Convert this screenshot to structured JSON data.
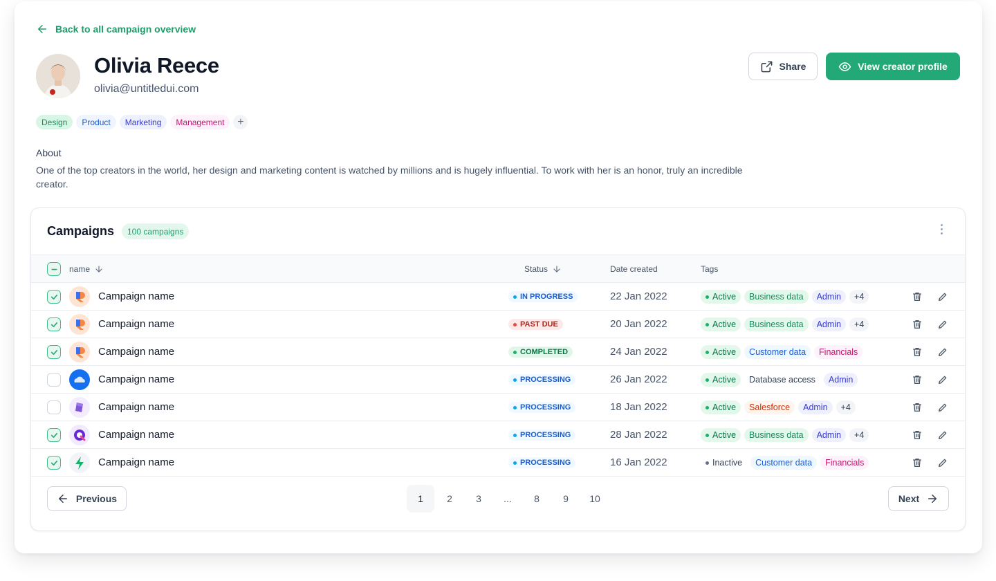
{
  "back_link": "Back to all campaign overview",
  "profile": {
    "name": "Olivia Reece",
    "email": "olivia@untitledui.com"
  },
  "actions": {
    "share_label": "Share",
    "view_label": "View creator profile"
  },
  "profile_tags": [
    {
      "label": "Design",
      "bg": "#d8f5e6",
      "fg": "#1f8a5b"
    },
    {
      "label": "Product",
      "bg": "#eff4ff",
      "fg": "#175cd3"
    },
    {
      "label": "Marketing",
      "bg": "#eef0fc",
      "fg": "#3538cd"
    },
    {
      "label": "Management",
      "bg": "#fdf2fa",
      "fg": "#c11574"
    }
  ],
  "add_tag": "+",
  "about": {
    "label": "About",
    "text": "One of the top creators in the world, her design and marketing content is watched by millions and is hugely influential. To work with her is an honor, truly an incredible creator."
  },
  "campaigns": {
    "title": "Campaigns",
    "count_badge": "100 campaigns",
    "columns": {
      "name": "name",
      "status": "Status",
      "date": "Date created",
      "tags": "Tags"
    },
    "rows": [
      {
        "checked": true,
        "logo": "r-logo-icon",
        "name": "Campaign name",
        "status": "IN PROGRESS",
        "date": "22 Jan 2022",
        "tags": [
          {
            "label": "Active",
            "kind": "active"
          },
          {
            "label": "Business data",
            "kind": "green"
          },
          {
            "label": "Admin",
            "kind": "indigo"
          },
          {
            "label": "+4",
            "kind": "gray"
          }
        ]
      },
      {
        "checked": true,
        "logo": "r-logo-icon",
        "name": "Campaign name",
        "status": "PAST DUE",
        "date": "20 Jan 2022",
        "tags": [
          {
            "label": "Active",
            "kind": "active"
          },
          {
            "label": "Business data",
            "kind": "green"
          },
          {
            "label": "Admin",
            "kind": "indigo"
          },
          {
            "label": "+4",
            "kind": "gray"
          }
        ]
      },
      {
        "checked": true,
        "logo": "r-logo-icon",
        "name": "Campaign name",
        "status": "COMPLETED",
        "date": "24 Jan 2022",
        "tags": [
          {
            "label": "Active",
            "kind": "active"
          },
          {
            "label": "Customer data",
            "kind": "blue"
          },
          {
            "label": "Financials",
            "kind": "pink"
          }
        ]
      },
      {
        "checked": false,
        "logo": "cloud-logo-icon",
        "name": "Campaign name",
        "status": "PROCESSING",
        "date": "26 Jan 2022",
        "tags": [
          {
            "label": "Active",
            "kind": "active"
          },
          {
            "label": "Database access",
            "kind": "plain"
          },
          {
            "label": "Admin",
            "kind": "indigo"
          }
        ]
      },
      {
        "checked": false,
        "logo": "cube-logo-icon",
        "name": "Campaign name",
        "status": "PROCESSING",
        "date": "18 Jan 2022",
        "tags": [
          {
            "label": "Active",
            "kind": "active"
          },
          {
            "label": "Salesforce",
            "kind": "orange"
          },
          {
            "label": "Admin",
            "kind": "indigo"
          },
          {
            "label": "+4",
            "kind": "gray"
          }
        ]
      },
      {
        "checked": true,
        "logo": "q-logo-icon",
        "name": "Campaign name",
        "status": "PROCESSING",
        "date": "28 Jan 2022",
        "tags": [
          {
            "label": "Active",
            "kind": "active"
          },
          {
            "label": "Business data",
            "kind": "green"
          },
          {
            "label": "Admin",
            "kind": "indigo"
          },
          {
            "label": "+4",
            "kind": "gray"
          }
        ]
      },
      {
        "checked": true,
        "logo": "bolt-logo-icon",
        "name": "Campaign name",
        "status": "PROCESSING",
        "date": "16 Jan 2022",
        "tags": [
          {
            "label": "Inactive",
            "kind": "inactive"
          },
          {
            "label": "Customer data",
            "kind": "blue"
          },
          {
            "label": "Financials",
            "kind": "pink"
          }
        ]
      }
    ]
  },
  "pagination": {
    "previous": "Previous",
    "next": "Next",
    "pages": [
      "1",
      "2",
      "3",
      "...",
      "8",
      "9",
      "10"
    ],
    "current": "1"
  },
  "colors": {
    "accent": "#23a978",
    "status_in_progress": "#0ba5ec",
    "status_past_due": "#e14a4a",
    "status_completed": "#17b26a",
    "status_processing": "#0ba5ec"
  }
}
